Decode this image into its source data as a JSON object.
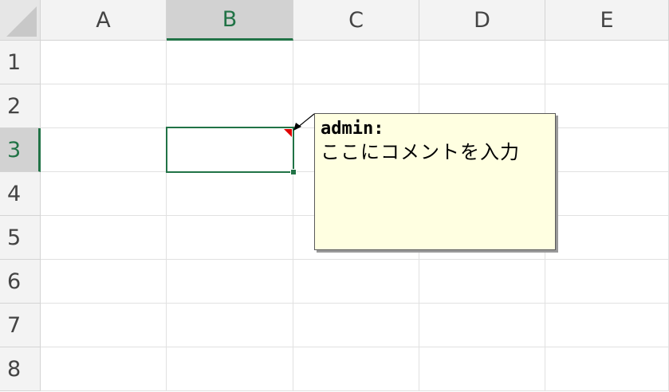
{
  "columns": [
    "A",
    "B",
    "C",
    "D",
    "E"
  ],
  "rows": [
    "1",
    "2",
    "3",
    "4",
    "5",
    "6",
    "7",
    "8"
  ],
  "selected_cell": {
    "column": "B",
    "row": "3"
  },
  "comment": {
    "author": "admin:",
    "text": "ここにコメントを入力"
  },
  "colors": {
    "accent": "#217346",
    "comment_background": "#ffffe1",
    "comment_indicator": "#e00000"
  }
}
